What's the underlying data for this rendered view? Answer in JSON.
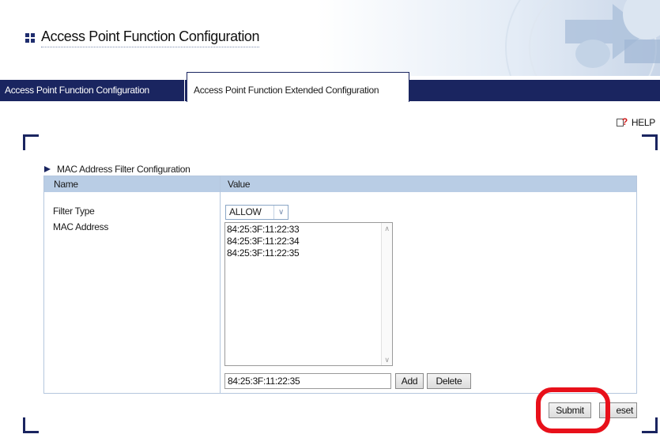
{
  "header": {
    "title": "Access Point Function Configuration"
  },
  "tabs": [
    {
      "label": "Access Point Function Configuration",
      "active": false
    },
    {
      "label": "Access Point Function Extended Configuration",
      "active": true
    }
  ],
  "help": {
    "label": "HELP",
    "icon": "help-icon"
  },
  "section": {
    "title": "MAC Address Filter Configuration",
    "columns": [
      "Name",
      "Value"
    ],
    "filter_type": {
      "label": "Filter Type",
      "value": "ALLOW"
    },
    "mac_address": {
      "label": "MAC Address",
      "list": [
        "84:25:3F:11:22:33",
        "84:25:3F:11:22:34",
        "84:25:3F:11:22:35"
      ],
      "input_value": "84:25:3F:11:22:35"
    }
  },
  "buttons": {
    "add": "Add",
    "delete": "Delete",
    "submit": "Submit",
    "reset": "eset"
  },
  "colors": {
    "navy": "#1a2560",
    "table_header": "#b9cde5",
    "highlight": "#e8101a"
  }
}
